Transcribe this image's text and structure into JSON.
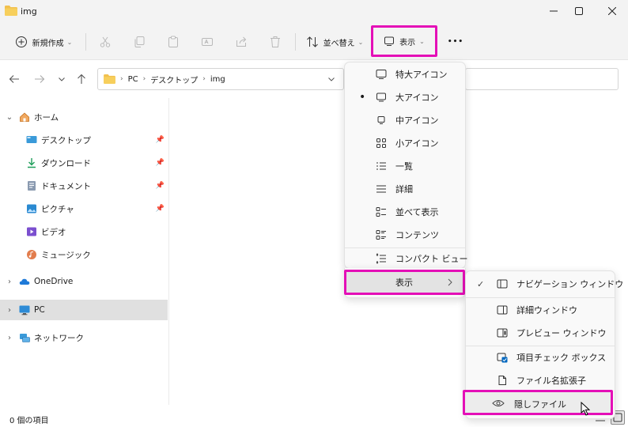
{
  "window": {
    "title": "img",
    "minimize_icon": "minimize-icon",
    "maximize_icon": "maximize-icon",
    "close_icon": "close-icon"
  },
  "toolbar": {
    "new_label": "新規作成",
    "sort_label": "並べ替え",
    "view_label": "表示",
    "more_label": "•••",
    "icons": [
      "cut-icon",
      "copy-icon",
      "paste-icon",
      "rename-icon",
      "share-icon",
      "delete-icon"
    ]
  },
  "address": {
    "segments": [
      "PC",
      "デスクトップ",
      "img"
    ]
  },
  "nav": {
    "home": "ホーム",
    "quick_access": [
      {
        "label": "デスクトップ",
        "icon": "desktop-icon"
      },
      {
        "label": "ダウンロード",
        "icon": "download-icon"
      },
      {
        "label": "ドキュメント",
        "icon": "document-icon"
      },
      {
        "label": "ピクチャ",
        "icon": "pictures-icon"
      },
      {
        "label": "ビデオ",
        "icon": "video-icon"
      },
      {
        "label": "ミュージック",
        "icon": "music-icon"
      }
    ],
    "onedrive": "OneDrive",
    "pc": "PC",
    "network": "ネットワーク"
  },
  "status": {
    "item_count": "0 個の項目"
  },
  "view_menu": {
    "items": [
      {
        "label": "特大アイコン",
        "icon": "extra-large-icons-icon"
      },
      {
        "label": "大アイコン",
        "icon": "large-icons-icon",
        "selected": true
      },
      {
        "label": "中アイコン",
        "icon": "medium-icons-icon"
      },
      {
        "label": "小アイコン",
        "icon": "small-icons-icon"
      },
      {
        "label": "一覧",
        "icon": "list-icon"
      },
      {
        "label": "詳細",
        "icon": "details-icon"
      },
      {
        "label": "並べて表示",
        "icon": "tiles-icon"
      },
      {
        "label": "コンテンツ",
        "icon": "content-icon"
      },
      {
        "label": "コンパクト ビュー",
        "icon": "compact-view-icon"
      }
    ],
    "show_label": "表示",
    "bullet": "•"
  },
  "show_submenu": {
    "check": "✓",
    "items": [
      {
        "label": "ナビゲーション ウィンドウ",
        "icon": "navigation-pane-icon",
        "checked": true
      },
      {
        "label": "詳細ウィンドウ",
        "icon": "details-pane-icon"
      },
      {
        "label": "プレビュー ウィンドウ",
        "icon": "preview-pane-icon"
      },
      {
        "label": "項目チェック ボックス",
        "icon": "item-checkbox-icon"
      },
      {
        "label": "ファイル名拡張子",
        "icon": "file-extension-icon"
      },
      {
        "label": "隠しファイル",
        "icon": "hidden-files-icon"
      }
    ]
  },
  "colors": {
    "highlight": "#e40fb7",
    "folder": "#f2c14e",
    "accent": "#0067c0"
  }
}
